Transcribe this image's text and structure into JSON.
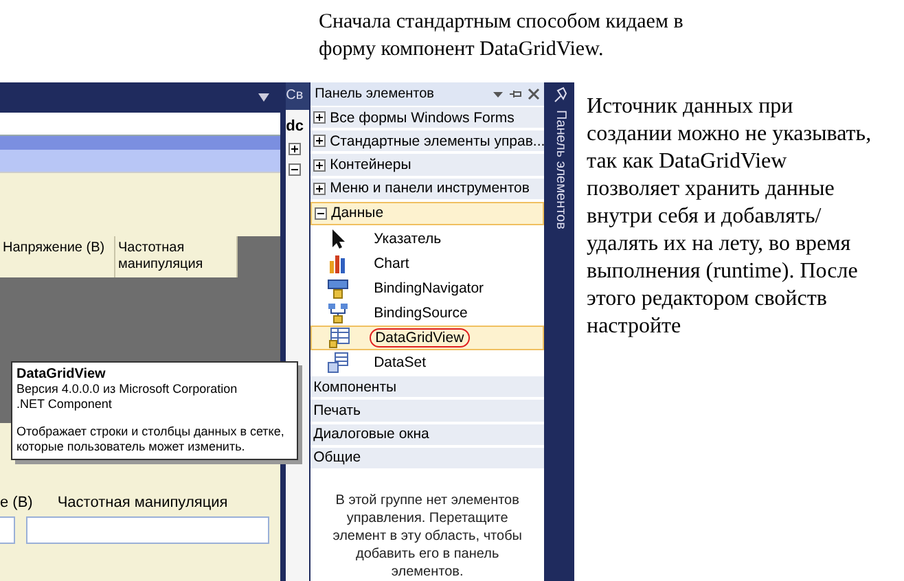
{
  "caption": "Сначала стандартным способом кидаем в форму компонент DataGridView.",
  "designer": {
    "grid_columns": [
      "Напряжение (В)",
      "Частотная манипуляция"
    ],
    "field_labels": [
      "е (В)",
      "Частотная манипуляция"
    ]
  },
  "tooltip": {
    "title": "DataGridView",
    "lines": [
      "Версия 4.0.0.0 из Microsoft Corporation",
      ".NET Component"
    ],
    "description": "Отображает строки и столбцы данных в сетке, которые пользователь может изменить."
  },
  "properties_panel": {
    "title": "Св",
    "object": "dc"
  },
  "toolbox": {
    "title": "Панель элементов",
    "groups": [
      {
        "label": "Все формы Windows Forms",
        "kind": "expandable",
        "expanded": false
      },
      {
        "label": "Стандартные элементы управ...",
        "kind": "expandable",
        "expanded": false
      },
      {
        "label": "Контейнеры",
        "kind": "expandable",
        "expanded": false
      },
      {
        "label": "Меню и панели инструментов",
        "kind": "expandable",
        "expanded": false
      },
      {
        "label": "Данные",
        "kind": "expandable",
        "expanded": true,
        "items": [
          {
            "label": "Указатель",
            "selected": false
          },
          {
            "label": "Chart",
            "selected": false
          },
          {
            "label": "BindingNavigator",
            "selected": false
          },
          {
            "label": "BindingSource",
            "selected": false
          },
          {
            "label": "DataGridView",
            "selected": true
          },
          {
            "label": "DataSet",
            "selected": false
          }
        ]
      },
      {
        "label": "Компоненты",
        "kind": "plain"
      },
      {
        "label": "Печать",
        "kind": "plain"
      },
      {
        "label": "Диалоговые окна",
        "kind": "plain"
      },
      {
        "label": "Общие",
        "kind": "plain"
      }
    ],
    "empty_message": "В этой группе нет элементов управления. Перетащите элемент в эту область, чтобы добавить его в панель элементов."
  },
  "side_tab": "Панель элементов",
  "side_note": "Источник данных при создании можно не указывать, так как DataGridView позволяет хранить данные внутри себя и добавлять/удалять их на лету, во время выполнения (runtime). После этого редактором свойств настройте"
}
